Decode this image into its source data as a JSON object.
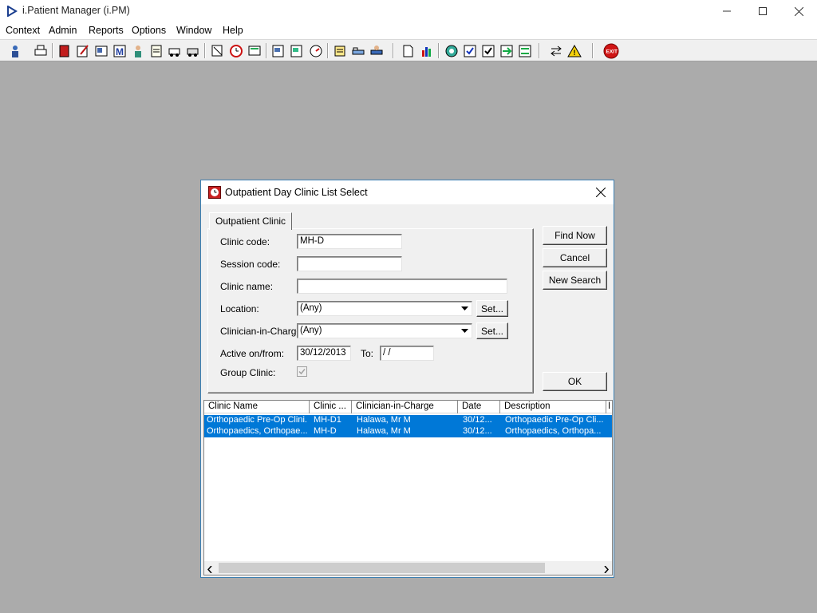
{
  "app": {
    "title": "i.Patient Manager (i.PM)"
  },
  "menu": [
    "Context",
    "Admin",
    "Reports",
    "Options",
    "Window",
    "Help"
  ],
  "toolbar": {
    "exit_label": "EXIT"
  },
  "dialog": {
    "title": "Outpatient Day Clinic List Select",
    "tab": "Outpatient Clinic",
    "fields": {
      "clinic_code_label": "Clinic code:",
      "clinic_code_value": "MH-D",
      "session_code_label": "Session code:",
      "session_code_value": "",
      "clinic_name_label": "Clinic name:",
      "clinic_name_value": "",
      "location_label": "Location:",
      "location_value": "(Any)",
      "clinician_label": "Clinician-in-Charge:",
      "clinician_value": "(Any)",
      "active_label": "Active on/from:",
      "active_value": "30/12/2013",
      "to_label": "To:",
      "to_value": " /  /",
      "group_clinic_label": "Group Clinic:",
      "group_clinic_checked": true
    },
    "buttons": {
      "set1": "Set...",
      "set2": "Set...",
      "find_now": "Find Now",
      "cancel": "Cancel",
      "new_search": "New Search",
      "ok": "OK"
    },
    "list": {
      "columns": [
        "Clinic Name",
        "Clinic ...",
        "Clinician-in-Charge",
        "Date",
        "Description",
        "I"
      ],
      "rows": [
        [
          "Orthopaedic Pre-Op Clini...",
          "MH-D1",
          "Halawa, Mr M",
          "30/12...",
          "Orthopaedic Pre-Op Cli..."
        ],
        [
          "Orthopaedics, Orthopae...",
          "MH-D",
          "Halawa, Mr M",
          "30/12...",
          "Orthopaedics, Orthopa..."
        ]
      ]
    }
  }
}
